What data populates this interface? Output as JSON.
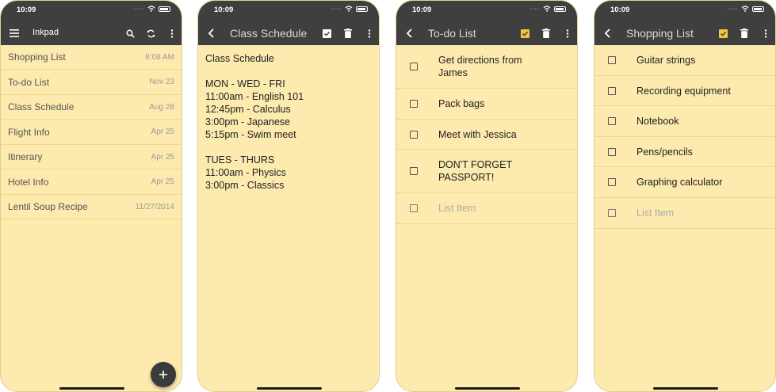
{
  "status_time": "10:09",
  "app": {
    "title": "Inkpad",
    "notes": [
      {
        "title": "Shopping List",
        "date": "8:08 AM"
      },
      {
        "title": "To-do List",
        "date": "Nov 23"
      },
      {
        "title": "Class Schedule",
        "date": "Aug 28"
      },
      {
        "title": "Flight Info",
        "date": "Apr 25"
      },
      {
        "title": "Itinerary",
        "date": "Apr 25"
      },
      {
        "title": "Hotel Info",
        "date": "Apr 25"
      },
      {
        "title": "Lentil Soup Recipe",
        "date": "11/27/2014"
      }
    ],
    "fab_label": "+"
  },
  "schedule": {
    "title": "Class Schedule",
    "lines": [
      "Class Schedule",
      "",
      "MON - WED - FRI",
      "11:00am - English 101",
      "12:45pm - Calculus",
      "3:00pm - Japanese",
      "5:15pm - Swim meet",
      "",
      "TUES - THURS",
      "11:00am - Physics",
      "3:00pm - Classics"
    ]
  },
  "todo": {
    "title": "To-do List",
    "items": [
      [
        "Get directions from",
        "James"
      ],
      [
        "Pack bags"
      ],
      [
        "Meet with Jessica"
      ],
      [
        "DON'T FORGET",
        "PASSPORT!"
      ]
    ],
    "placeholder": "List Item"
  },
  "shopping": {
    "title": "Shopping List",
    "items": [
      "Guitar strings",
      "Recording equipment",
      "Notebook",
      "Pens/pencils",
      "Graphing calculator"
    ],
    "placeholder": "List Item"
  },
  "colors": {
    "toolbar": "#3f3f3f",
    "paper": "#fdeaae",
    "checklist_toggle_active": "#f5c542"
  },
  "icons": {
    "menu": "menu-icon",
    "search": "search-icon",
    "sync": "sync-icon",
    "more": "more-vert-icon",
    "back": "back-arrow-icon",
    "checkbox": "checkbox-icon",
    "delete": "trash-icon",
    "add": "plus-icon"
  }
}
